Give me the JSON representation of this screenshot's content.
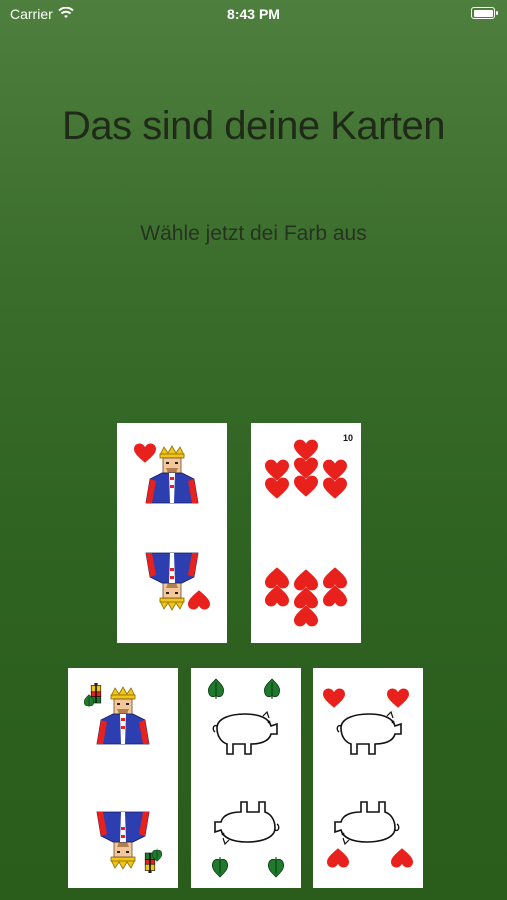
{
  "status": {
    "carrier": "Carrier",
    "time": "8:43 PM"
  },
  "header": {
    "title": "Das sind deine Karten",
    "subtitle": "Wähle jetzt dei Farb aus"
  },
  "cards": [
    {
      "suit": "hearts",
      "rank": "King"
    },
    {
      "suit": "hearts",
      "rank": "10",
      "corner_label": "10"
    },
    {
      "suit": "bells",
      "rank": "King"
    },
    {
      "suit": "leaves",
      "rank": "Ace"
    },
    {
      "suit": "hearts",
      "rank": "Ace"
    }
  ],
  "colors": {
    "heart": "#e8211c",
    "leaf": "#1f7a2e",
    "card": "#ffffff",
    "crown": "#f0c419",
    "robe": "#2d3fb0"
  }
}
